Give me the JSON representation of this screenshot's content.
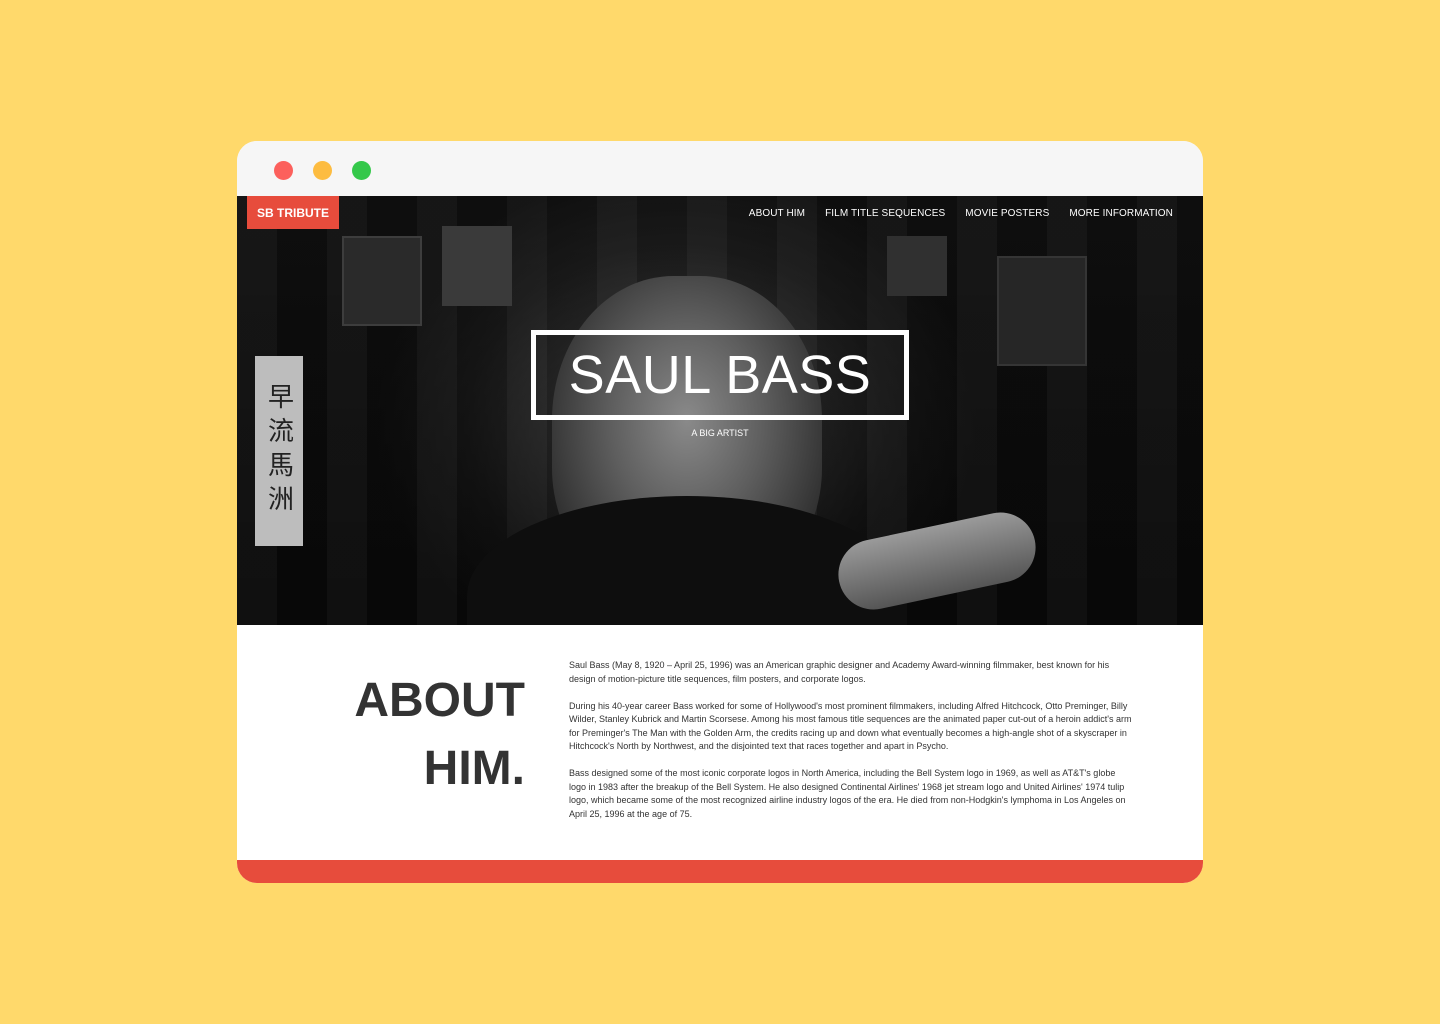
{
  "colors": {
    "background": "#FFD96B",
    "accent": "#E74C3C",
    "window_red": "#FC605C",
    "window_yellow": "#FDBC40",
    "window_green": "#34C84A"
  },
  "window": {
    "controls": [
      "close",
      "minimize",
      "maximize"
    ]
  },
  "header": {
    "logo": "SB TRIBUTE",
    "nav": [
      {
        "label": "ABOUT HIM"
      },
      {
        "label": "FILM TITLE SEQUENCES"
      },
      {
        "label": "MOVIE POSTERS"
      },
      {
        "label": "MORE INFORMATION"
      }
    ]
  },
  "hero": {
    "title": "SAUL BASS",
    "subtitle": "A BIG ARTIST",
    "scroll_text": "早流馬洲"
  },
  "about": {
    "heading_line1": "ABOUT",
    "heading_line2": "HIM.",
    "paragraphs": [
      "Saul Bass (May 8, 1920 – April 25, 1996) was an American graphic designer and Academy Award-winning filmmaker, best known for his design of motion-picture title sequences, film posters, and corporate logos.",
      "During his 40-year career Bass worked for some of Hollywood's most prominent filmmakers, including Alfred Hitchcock, Otto Preminger, Billy Wilder, Stanley Kubrick and Martin Scorsese. Among his most famous title sequences are the animated paper cut-out of a heroin addict's arm for Preminger's The Man with the Golden Arm, the credits racing up and down what eventually becomes a high-angle shot of a skyscraper in Hitchcock's North by Northwest, and the disjointed text that races together and apart in Psycho.",
      "Bass designed some of the most iconic corporate logos in North America, including the Bell System logo in 1969, as well as AT&T's globe logo in 1983 after the breakup of the Bell System. He also designed Continental Airlines' 1968 jet stream logo and United Airlines' 1974 tulip logo, which became some of the most recognized airline industry logos of the era. He died from non-Hodgkin's lymphoma in Los Angeles on April 25, 1996 at the age of 75."
    ]
  }
}
